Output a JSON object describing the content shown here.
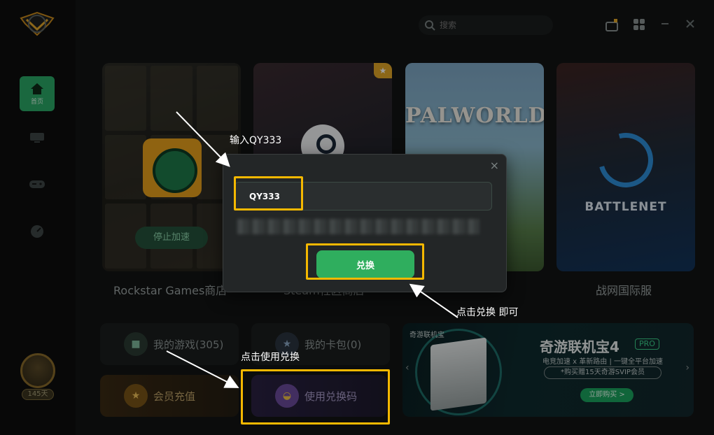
{
  "app": {
    "accent": "#2aa866",
    "sidebar": {
      "home_label": "首页",
      "days_badge": "145天"
    },
    "topbar": {
      "search_placeholder": "搜索"
    },
    "games": [
      {
        "title": "Rockstar Games商店",
        "action": "停止加速"
      },
      {
        "title": "Steam社区商店"
      },
      {
        "title": "PALWORLD",
        "logo_text": "PALWORLD"
      },
      {
        "title": "战网国际服",
        "logo_text": "BATTLENET"
      }
    ],
    "tiles": {
      "my_games": "我的游戏(305)",
      "my_cards": "我的卡包(0)",
      "vip": "会员充值",
      "redeem": "使用兑换码"
    },
    "banner": {
      "brand": "奇游联机宝",
      "title": "奇游联机宝4",
      "pro": "PRO",
      "subtitle": "电竞加速 x 革新路由 | 一键全平台加速",
      "promo": "*购买赠15天奇游SVIP会员",
      "buy": "立即购买 >"
    }
  },
  "modal": {
    "close": "×",
    "code_value": "QY333",
    "redeem_button": "兑换"
  },
  "annotations": {
    "highlight_color": "#f5b800",
    "step_input": "输入QY333",
    "step_click_redeem": "点击兑换 即可",
    "step_use_code": "点击使用兑换"
  }
}
